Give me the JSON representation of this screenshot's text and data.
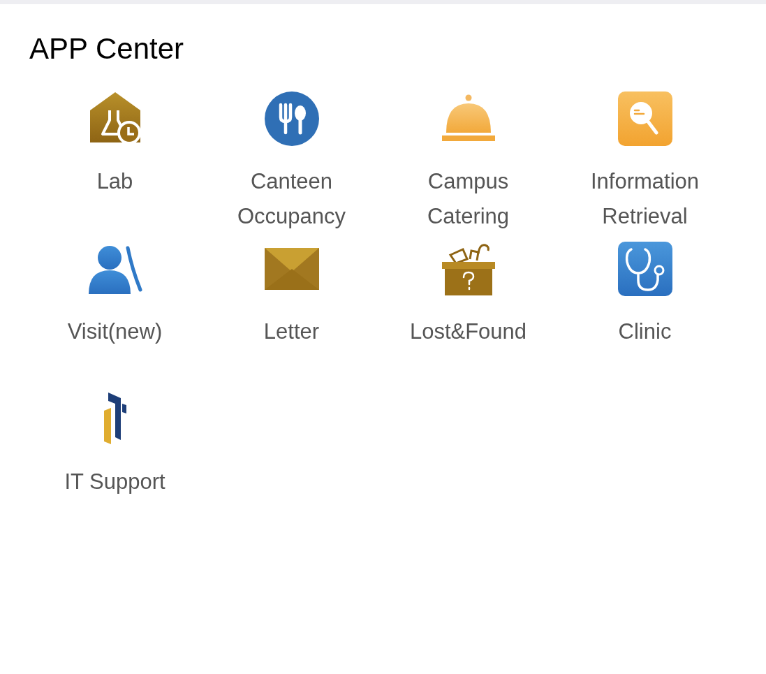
{
  "title": "APP Center",
  "apps": [
    {
      "label": "Lab"
    },
    {
      "label": "Canteen Occupancy"
    },
    {
      "label": "Campus Catering"
    },
    {
      "label": "Information Retrieval"
    },
    {
      "label": "Visit(new)"
    },
    {
      "label": "Letter"
    },
    {
      "label": "Lost&Found"
    },
    {
      "label": "Clinic"
    },
    {
      "label": "IT Support"
    }
  ]
}
